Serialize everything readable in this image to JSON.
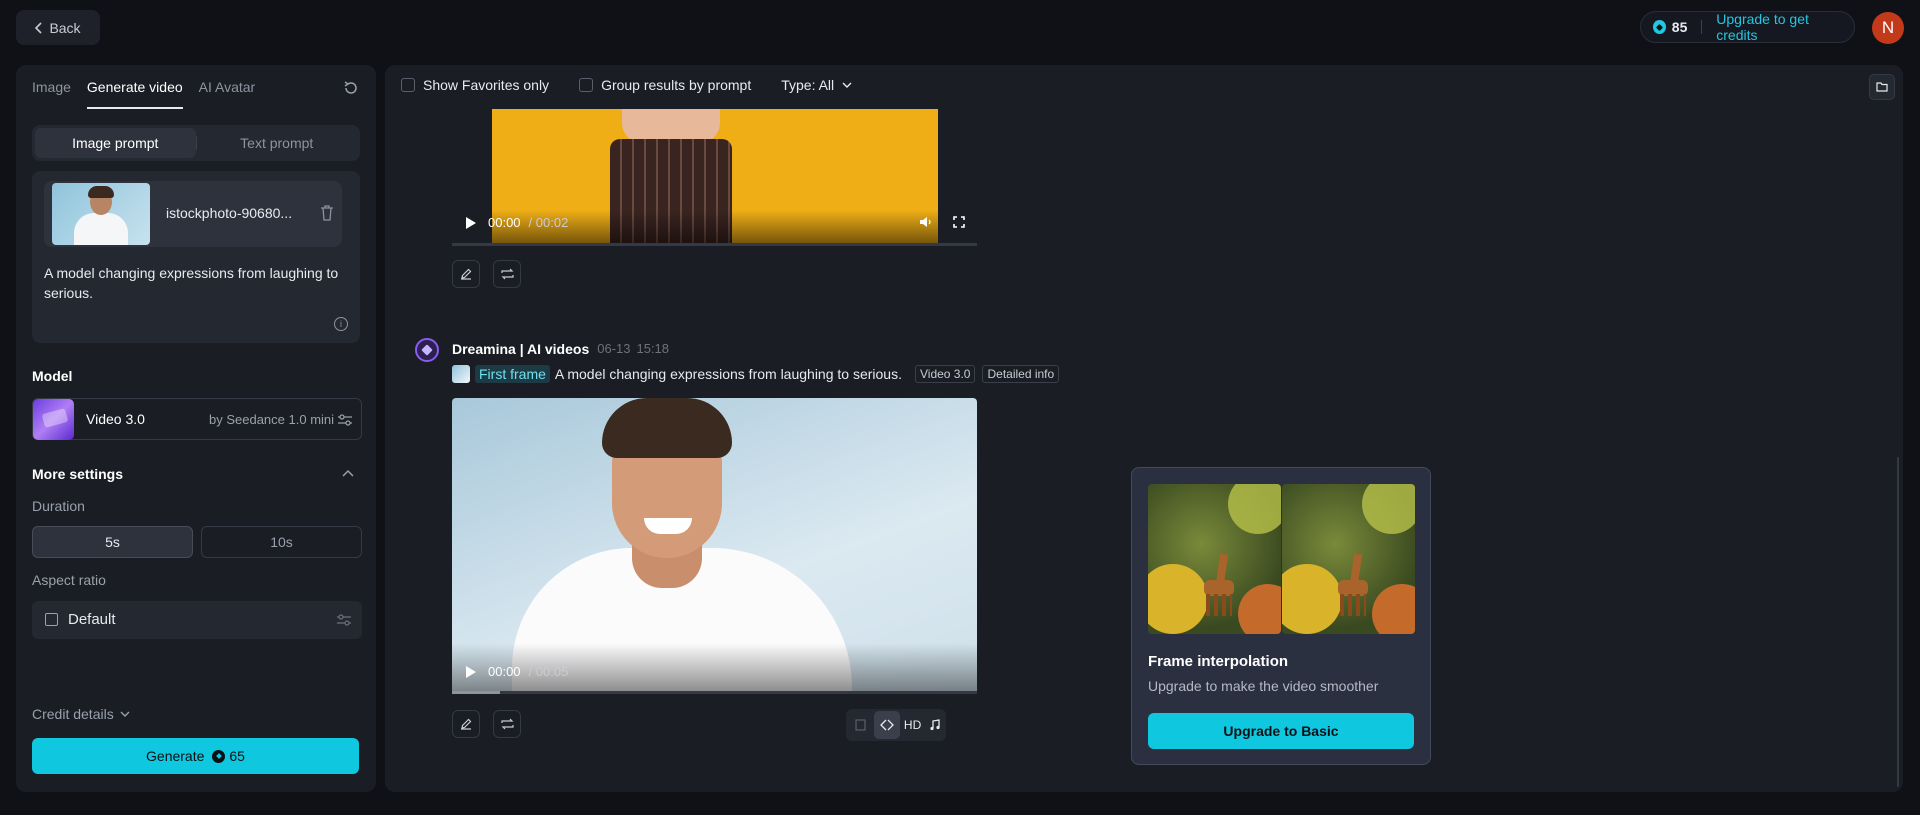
{
  "topbar": {
    "back_label": "Back",
    "credits_count": "85",
    "upgrade_label": "Upgrade to get credits",
    "avatar_initial": "N"
  },
  "left": {
    "tabs": [
      {
        "label": "Image"
      },
      {
        "label": "Generate video",
        "active": true
      },
      {
        "label": "AI Avatar"
      }
    ],
    "prompt_modes": [
      {
        "label": "Image prompt",
        "active": true
      },
      {
        "label": "Text prompt"
      }
    ],
    "image_name": "istockphoto-90680...",
    "prompt_text": "A model changing expressions from laughing to serious.",
    "model_label": "Model",
    "model_name": "Video 3.0",
    "model_by": "by Seedance 1.0 mini",
    "more_settings": "More settings",
    "duration_label": "Duration",
    "durations": [
      {
        "label": "5s",
        "active": true
      },
      {
        "label": "10s"
      }
    ],
    "aspect_label": "Aspect ratio",
    "aspect_value": "Default",
    "credit_details": "Credit details",
    "generate_label": "Generate",
    "generate_cost": "65"
  },
  "main": {
    "filters": {
      "favorites": "Show Favorites only",
      "group": "Group results by prompt",
      "type": "Type: All"
    },
    "video1": {
      "time_current": "00:00",
      "time_total": "/ 00:02"
    },
    "item2": {
      "author": "Dreamina | AI videos",
      "date": "06-13",
      "time": "15:18",
      "first_frame_label": "First frame",
      "prompt": "A model changing expressions from laughing to serious.",
      "tag_model": "Video 3.0",
      "tag_info": "Detailed info",
      "time_current": "00:00",
      "time_total": "/ 00:05",
      "toolbar_hd": "HD"
    },
    "popover": {
      "title": "Frame interpolation",
      "subtitle": "Upgrade to make the video smoother",
      "button": "Upgrade to Basic"
    }
  },
  "colors": {
    "accent": "#0fc8e0",
    "background": "#0f1116",
    "panel": "#1a1d24"
  },
  "icons": [
    "chevron-left-icon",
    "coin-icon",
    "refresh-icon",
    "trash-icon",
    "info-icon",
    "sliders-icon",
    "chevron-up-icon",
    "ratio-icon",
    "chevron-down-icon",
    "folder-icon",
    "play-icon",
    "volume-icon",
    "fullscreen-icon",
    "edit-icon",
    "regenerate-icon",
    "frame-icon",
    "interpolation-icon",
    "music-icon"
  ]
}
